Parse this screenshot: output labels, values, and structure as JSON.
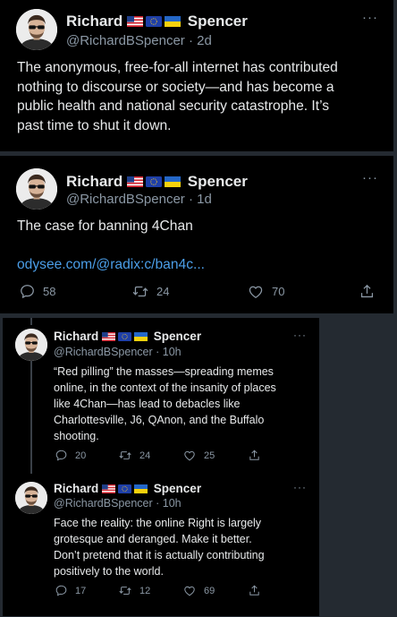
{
  "tweet1": {
    "name_first": "Richard",
    "name_last": "Spencer",
    "handle": "@RichardBSpencer · 2d",
    "text": "The anonymous, free-for-all internet has contributed\nnothing to discourse or society—and has become a\npublic health and national security catastrophe. It’s\npast time to shut it down."
  },
  "tweet2": {
    "name_first": "Richard",
    "name_last": "Spencer",
    "handle": "@RichardBSpencer · 1d",
    "text": "The case for banning 4Chan",
    "link": "odysee.com/@radix:c/ban4c...",
    "replies": "58",
    "retweets": "24",
    "likes": "70"
  },
  "tweet3": {
    "name_first": "Richard",
    "name_last": "Spencer",
    "handle": "@RichardBSpencer · 10h",
    "text": "“Red pilling” the masses—spreading memes\nonline, in the context of the insanity of places\nlike 4Chan—has lead to debacles like\nCharlottesville, J6, QAnon, and the Buffalo\nshooting.",
    "replies": "20",
    "retweets": "24",
    "likes": "25"
  },
  "tweet4": {
    "name_first": "Richard",
    "name_last": "Spencer",
    "handle": "@RichardBSpencer · 10h",
    "text": "Face the reality: the online Right is largely\ngrotesque and deranged. Make it better.\nDon’t pretend that it is actually contributing\npositively to the world.",
    "replies": "17",
    "retweets": "12",
    "likes": "69"
  },
  "more_glyph": "···",
  "icons": [
    "reply-icon",
    "retweet-icon",
    "like-icon",
    "share-icon",
    "more-icon",
    "flag-us-icon",
    "flag-eu-icon",
    "flag-ukraine-icon"
  ]
}
